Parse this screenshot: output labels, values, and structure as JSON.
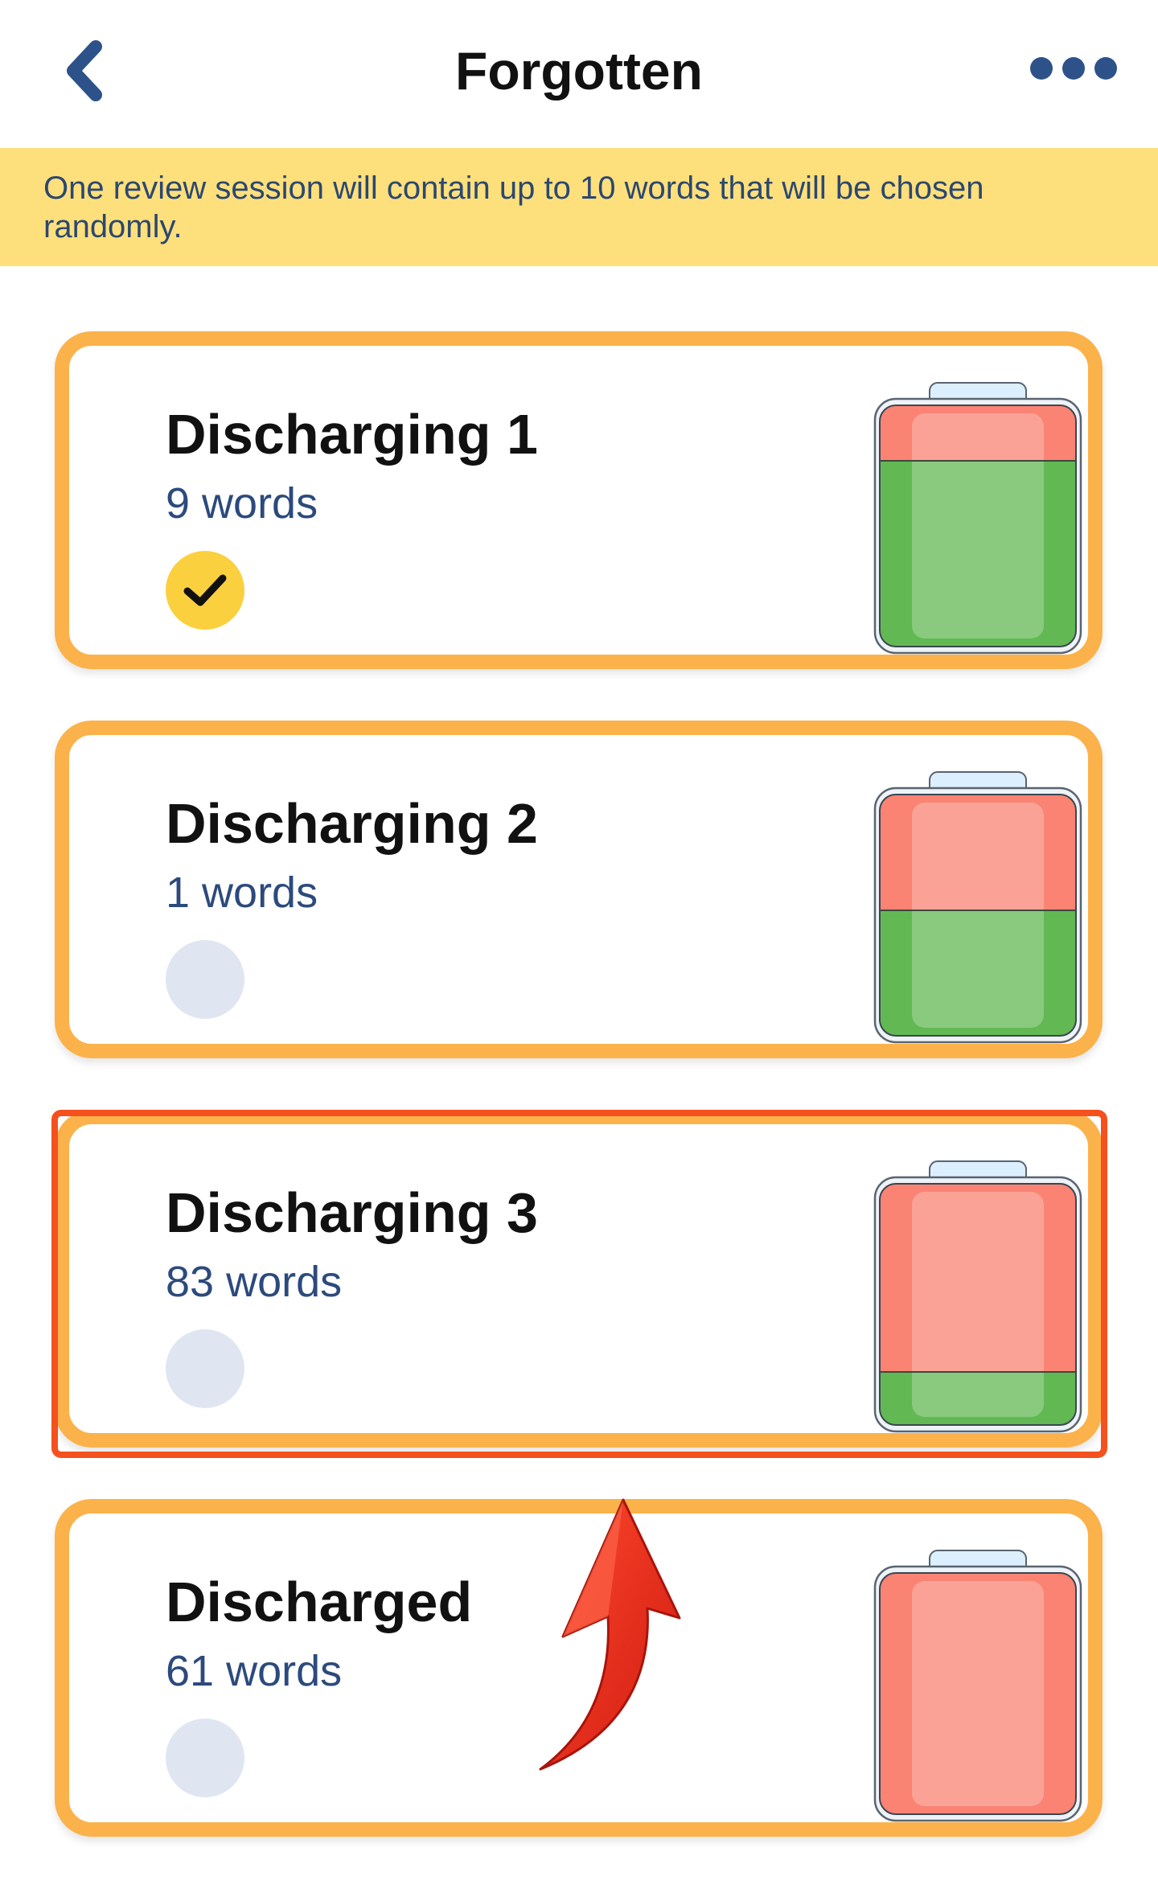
{
  "header": {
    "title": "Forgotten"
  },
  "banner": {
    "text": "One review session will contain up to 10 words that will be chosen randomly."
  },
  "cards": [
    {
      "name": "Discharging 1",
      "count": "9 words",
      "selected": true,
      "charge": 0.77
    },
    {
      "name": "Discharging 2",
      "count": "1 words",
      "selected": false,
      "charge": 0.52
    },
    {
      "name": "Discharging 3",
      "count": "83 words",
      "selected": false,
      "charge": 0.22
    },
    {
      "name": "Discharged",
      "count": "61 words",
      "selected": false,
      "charge": 0.0
    }
  ],
  "colors": {
    "accent_border": "#fbb24a",
    "highlight": "#f4511e",
    "battery_green": "#62b953",
    "battery_red": "#fa8373",
    "checked": "#fbd03f",
    "unchecked": "#dfe6f1"
  },
  "icons": {
    "back": "chevron-left-icon",
    "more": "ellipsis-icon",
    "check": "checkmark-icon",
    "battery": "battery-icon",
    "arrow": "curved-arrow-icon"
  }
}
